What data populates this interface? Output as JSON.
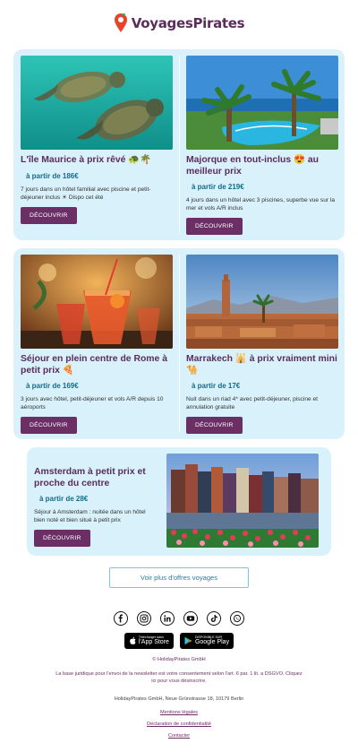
{
  "brand": {
    "name": "VoyagesPirates"
  },
  "offers": [
    {
      "title": "L'île Maurice à prix rêvé 🐢🌴",
      "price": "à partir de 186€",
      "desc": "7 jours dans un hôtel familial avec piscine et petit-déjeuner inclus ☀ Dispo cet été",
      "cta": "DÉCOUVRIR"
    },
    {
      "title": "Majorque en tout-inclus 😍 au meilleur prix",
      "price": "à partir de 219€",
      "desc": "4 jours dans un hôtel avec 3 piscines, superbe vue sur la mer et vols A/R inclus",
      "cta": "DÉCOUVRIR"
    },
    {
      "title": "Séjour en plein centre de Rome à petit prix 🍕",
      "price": "à partir de 169€",
      "desc": "3 jours avec hôtel, petit-déjeuner et vols A/R depuis 10 aéroports",
      "cta": "DÉCOUVRIR"
    },
    {
      "title": "Marrakech 🕌 à prix vraiment mini 🐪",
      "price": "à partir de 17€",
      "desc": "Nuit dans un riad 4* avec petit-déjeuner, piscine et annulation gratuite",
      "cta": "DÉCOUVRIR"
    },
    {
      "title": "Amsterdam à petit prix et proche du centre",
      "price": "à partir de 28€",
      "desc": "Séjour à Amsterdam : nuitée dans un hôtel bien noté et bien situé à petit prix",
      "cta": "DÉCOUVRIR"
    }
  ],
  "more_offers": "Voir plus d'offres voyages",
  "stores": {
    "apple_small": "Télécharger dans",
    "apple_big": "l'App Store",
    "google_small": "DISPONIBLE SUR",
    "google_big": "Google Play"
  },
  "footer": {
    "copyright": "© HolidayPirates GmbH",
    "legal": "La base juridique pour l'envoi de la newsletter est votre consentement selon l'art. 6 par. 1 lit. a DSGVO. Cliquez ici pour vous désinscrire.",
    "address": "HolidayPirates GmbH, Neue Grünstrasse 18, 10179 Berlin",
    "link_legal": "Mentions légales",
    "link_privacy": "Déclaration de confidentialité",
    "link_contact": "Contacter"
  },
  "colors": {
    "brand": "#5a2d5c",
    "button": "#6b2f66",
    "card_bg": "#d8f1fb",
    "price": "#146b8a"
  },
  "icons": [
    "facebook-icon",
    "instagram-icon",
    "linkedin-icon",
    "youtube-icon",
    "tiktok-icon",
    "whatsapp-icon"
  ]
}
